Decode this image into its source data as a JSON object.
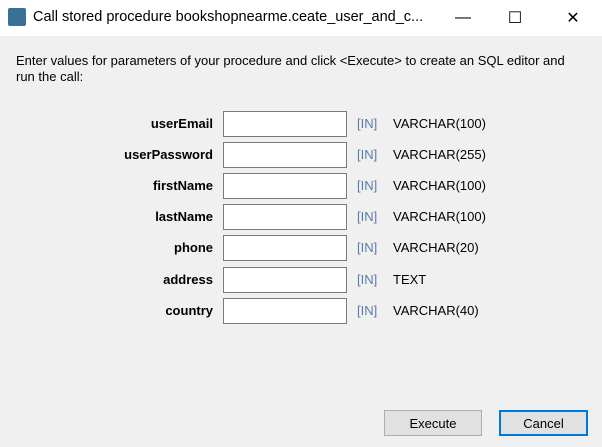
{
  "window": {
    "title": "Call stored procedure bookshopnearme.ceate_user_and_c...",
    "minimize": "—",
    "maximize": "☐",
    "close": "✕"
  },
  "intro": "Enter values for parameters of your procedure and click <Execute> to create an SQL editor and run the call:",
  "params": [
    {
      "name": "userEmail",
      "value": "",
      "mode": "[IN]",
      "type": "VARCHAR(100)"
    },
    {
      "name": "userPassword",
      "value": "",
      "mode": "[IN]",
      "type": "VARCHAR(255)"
    },
    {
      "name": "firstName",
      "value": "",
      "mode": "[IN]",
      "type": "VARCHAR(100)"
    },
    {
      "name": "lastName",
      "value": "",
      "mode": "[IN]",
      "type": "VARCHAR(100)"
    },
    {
      "name": "phone",
      "value": "",
      "mode": "[IN]",
      "type": "VARCHAR(20)"
    },
    {
      "name": "address",
      "value": "",
      "mode": "[IN]",
      "type": "TEXT"
    },
    {
      "name": "country",
      "value": "",
      "mode": "[IN]",
      "type": "VARCHAR(40)"
    }
  ],
  "buttons": {
    "execute": "Execute",
    "cancel": "Cancel"
  }
}
